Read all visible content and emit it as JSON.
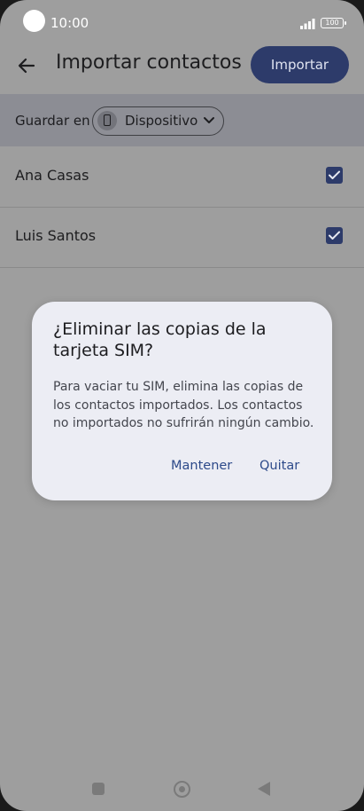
{
  "status_bar": {
    "time": "10:00",
    "battery": "100"
  },
  "header": {
    "title": "Importar contactos",
    "import_button": "Importar"
  },
  "save_bar": {
    "label": "Guardar en",
    "selected": "Dispositivo"
  },
  "contacts": [
    {
      "name": "Ana Casas",
      "checked": true
    },
    {
      "name": "Luis Santos",
      "checked": true
    }
  ],
  "dialog": {
    "title": "¿Eliminar las copias de la tarjeta SIM?",
    "body": "Para vaciar tu SIM, elimina las copias de los contactos importados. Los contactos no importados no sufrirán ningún cambio.",
    "keep_button": "Mantener",
    "remove_button": "Quitar"
  },
  "colors": {
    "accent": "#2d3b6a",
    "scrim": "#9e9e9e",
    "dialog_bg": "#ecedf4",
    "dialog_button_text": "#2d4a8a"
  },
  "icons": [
    "back-arrow-icon",
    "phone-icon",
    "chevron-down-icon",
    "checkbox-checked-icon",
    "signal-icon",
    "battery-icon",
    "nav-recents-icon",
    "nav-home-icon",
    "nav-back-icon"
  ]
}
